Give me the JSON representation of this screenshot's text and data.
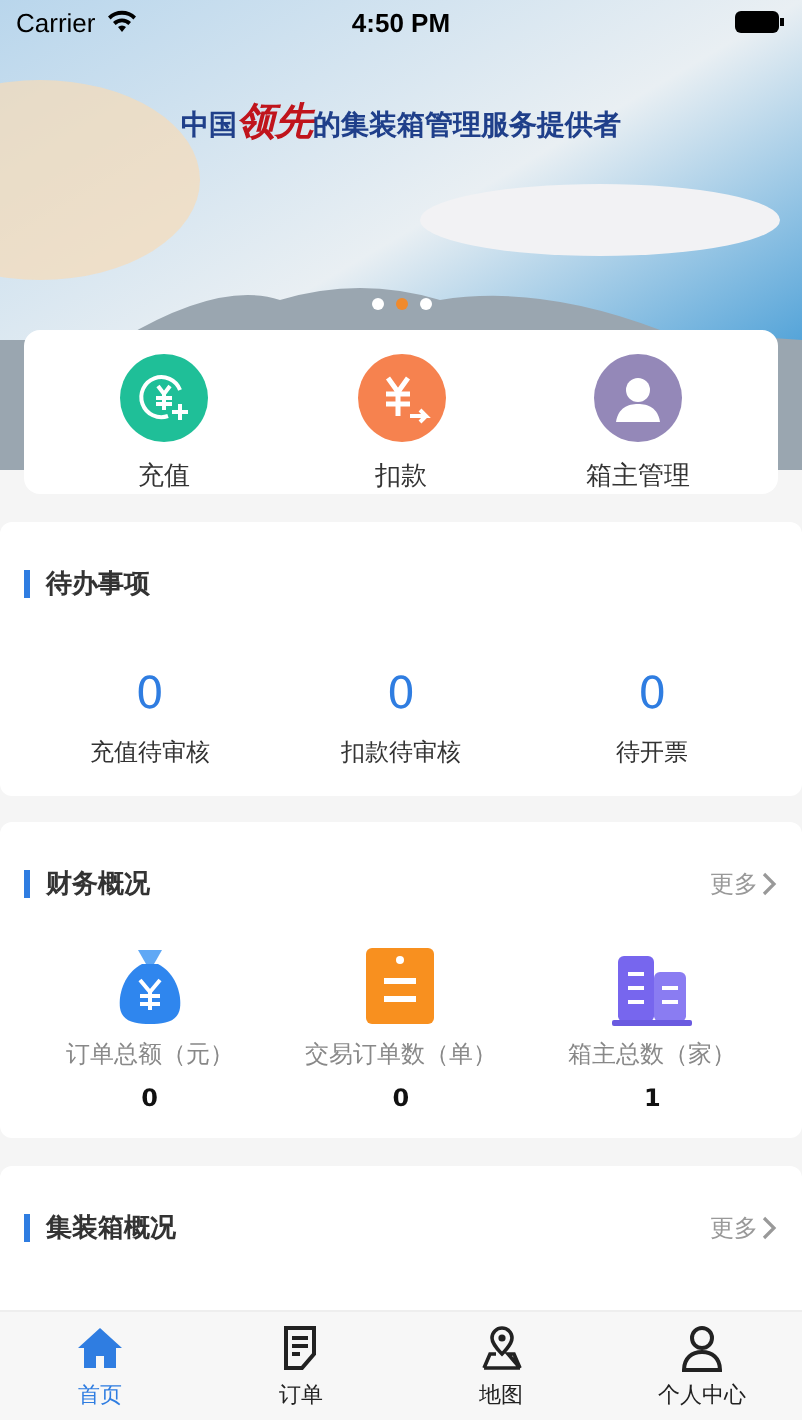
{
  "status_bar": {
    "carrier": "Carrier",
    "time": "4:50 PM"
  },
  "banner": {
    "caption": "中国**领先**的集装箱管理服务提供者",
    "dots": [
      {
        "selected": false
      },
      {
        "selected": true
      },
      {
        "selected": false
      }
    ]
  },
  "quick_actions": [
    {
      "label": "充值",
      "kind": "recharge"
    },
    {
      "label": "扣款",
      "kind": "deduct"
    },
    {
      "label": "箱主管理",
      "kind": "owner"
    }
  ],
  "todo": {
    "title": "待办事项",
    "items": [
      {
        "value": "0",
        "label": "充值待审核"
      },
      {
        "value": "0",
        "label": "扣款待审核"
      },
      {
        "value": "0",
        "label": "待开票"
      }
    ]
  },
  "finance": {
    "title": "财务概况",
    "more": "更多",
    "items": [
      {
        "kind": "money",
        "label": "订单总额（元）",
        "value": "0"
      },
      {
        "kind": "order",
        "label": "交易订单数（单）",
        "value": "0"
      },
      {
        "kind": "building",
        "label": "箱主总数（家）",
        "value": "1"
      }
    ]
  },
  "containers": {
    "title": "集装箱概况",
    "more": "更多"
  },
  "tab_bar": [
    {
      "label": "首页",
      "kind": "home",
      "selected": true
    },
    {
      "label": "订单",
      "kind": "order",
      "selected": false
    },
    {
      "label": "地图",
      "kind": "map",
      "selected": false
    },
    {
      "label": "个人中心",
      "kind": "user",
      "selected": false
    }
  ]
}
